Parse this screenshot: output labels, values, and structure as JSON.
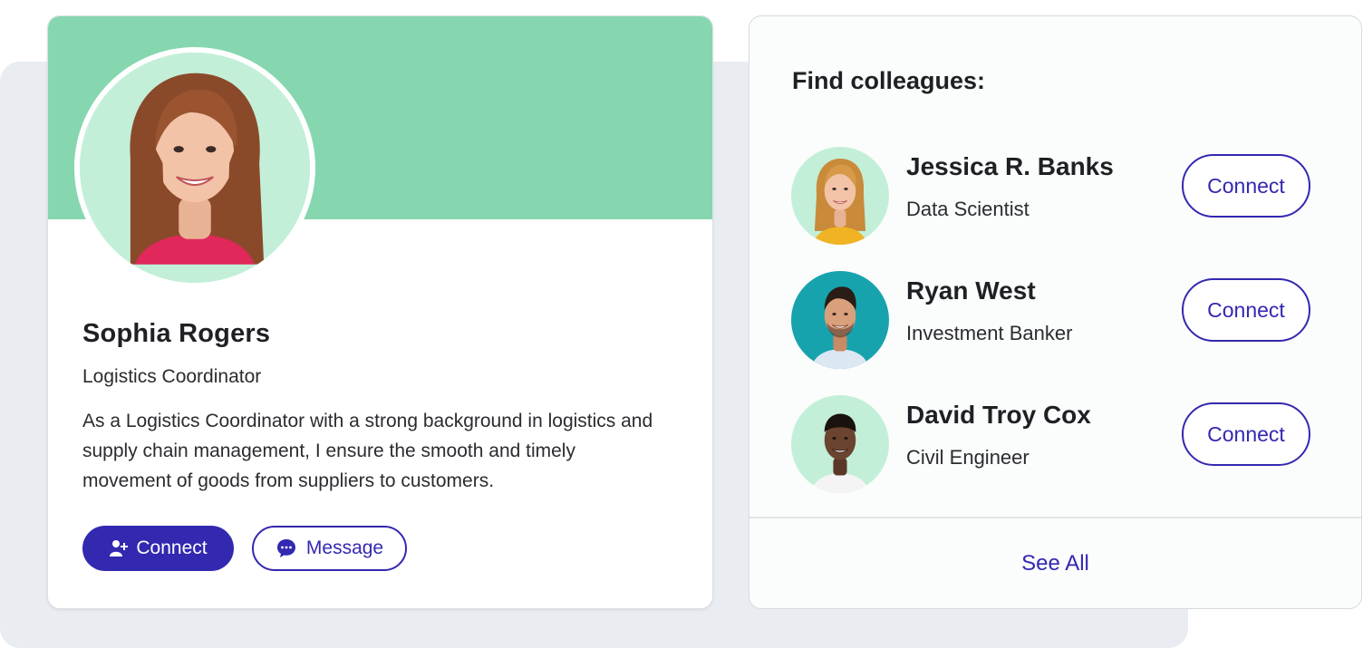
{
  "profile": {
    "name": "Sophia Rogers",
    "title": "Logistics Coordinator",
    "bio": "As a Logistics Coordinator with a strong background in logistics and supply chain management, I ensure the smooth and timely movement of goods from suppliers to customers.",
    "connect_label": "Connect",
    "message_label": "Message",
    "cover_color": "#86d7af"
  },
  "colleagues": {
    "heading": "Find colleagues:",
    "people": [
      {
        "name": "Jessica R. Banks",
        "role": "Data Scientist",
        "action": "Connect",
        "avatar_bg": "#c3efd9"
      },
      {
        "name": "Ryan West",
        "role": "Investment Banker",
        "action": "Connect",
        "avatar_bg": "#17a3ad"
      },
      {
        "name": "David Troy Cox",
        "role": "Civil Engineer",
        "action": "Connect",
        "avatar_bg": "#c3efd9"
      }
    ],
    "see_all": "See All"
  },
  "colors": {
    "accent": "#3328b0",
    "mint": "#86d7af",
    "backdrop": "#e9ecf1"
  }
}
